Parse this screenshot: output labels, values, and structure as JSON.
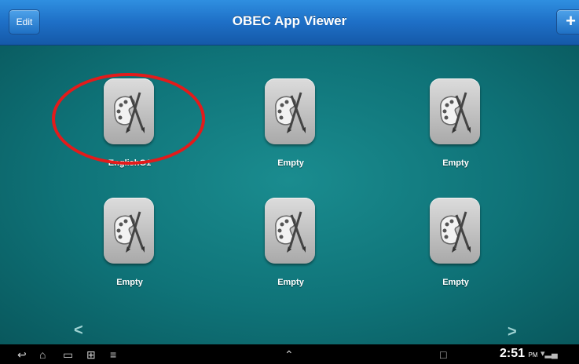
{
  "header": {
    "title": "OBEC App Viewer",
    "edit_label": "Edit",
    "add_label": "+"
  },
  "tiles": [
    {
      "label": "EnglishG1",
      "icon": "palette-icon"
    },
    {
      "label": "Empty",
      "icon": "palette-icon"
    },
    {
      "label": "Empty",
      "icon": "palette-icon"
    },
    {
      "label": "Empty",
      "icon": "palette-icon"
    },
    {
      "label": "Empty",
      "icon": "palette-icon"
    },
    {
      "label": "Empty",
      "icon": "palette-icon"
    }
  ],
  "pager": {
    "prev_glyph": "<",
    "next_glyph": ">"
  },
  "system_bar": {
    "time": "2:51",
    "ampm": "PM",
    "icons": [
      "back-icon",
      "home-icon",
      "recent-apps-icon",
      "screenshot-icon",
      "menu-icon",
      "up-icon",
      "usb-icon",
      "wifi-icon",
      "signal-icon",
      "battery-icon"
    ]
  },
  "colors": {
    "header": "#1e6fc6",
    "background": "#0f7378",
    "highlight": "#e31b1b"
  }
}
